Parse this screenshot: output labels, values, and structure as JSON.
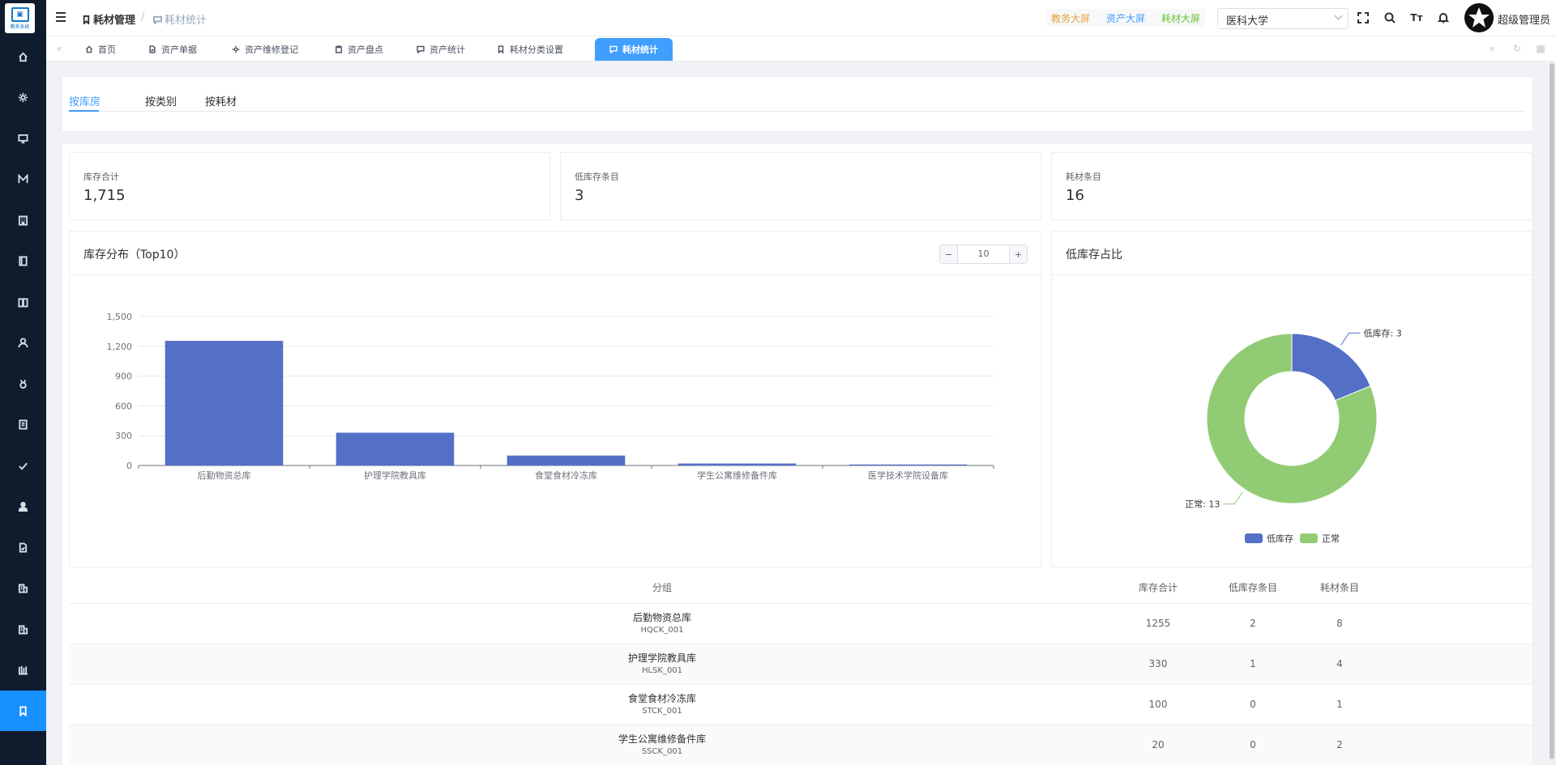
{
  "app": {
    "logo_caption": "教务系统"
  },
  "header": {
    "breadcrumb": [
      "耗材管理",
      "/",
      "耗材统计"
    ],
    "screen_links": [
      "教务大屏",
      "资产大屏",
      "耗材大屏"
    ],
    "org_select": "医科大学",
    "font_icon_text": "Tт",
    "user": "超级管理员"
  },
  "sidebar": {
    "items": [
      {
        "icon": "home-icon"
      },
      {
        "icon": "settings-icon"
      },
      {
        "icon": "monitor-icon"
      },
      {
        "icon": "brand-m-icon"
      },
      {
        "icon": "building-icon"
      },
      {
        "icon": "book-icon"
      },
      {
        "icon": "open-book-icon"
      },
      {
        "icon": "user-icon"
      },
      {
        "icon": "medal-icon"
      },
      {
        "icon": "notebook-icon"
      },
      {
        "icon": "check-icon"
      },
      {
        "icon": "person-icon"
      },
      {
        "icon": "document-icon"
      },
      {
        "icon": "office-icon"
      },
      {
        "icon": "office2-icon"
      },
      {
        "icon": "library-icon"
      },
      {
        "icon": "bookmark-icon",
        "active": true
      }
    ]
  },
  "tags": [
    {
      "label": "首页",
      "icon": "home-icon"
    },
    {
      "label": "资产单据",
      "icon": "document-icon"
    },
    {
      "label": "资产维修登记",
      "icon": "gear-icon"
    },
    {
      "label": "资产盘点",
      "icon": "clipboard-icon"
    },
    {
      "label": "资产统计",
      "icon": "chat-icon"
    },
    {
      "label": "耗材分类设置",
      "icon": "bookmark-icon"
    },
    {
      "label": "耗材统计",
      "icon": "chat-icon",
      "active": true
    }
  ],
  "subtabs": [
    "按库房",
    "按类别",
    "按耗材"
  ],
  "stats": [
    {
      "label": "库存合计",
      "value": "1,715"
    },
    {
      "label": "低库存条目",
      "value": "3"
    },
    {
      "label": "耗材条目",
      "value": "16"
    }
  ],
  "bar_panel": {
    "title": "库存分布（Top10）",
    "stepper_value": "10",
    "minus": "−",
    "plus": "+"
  },
  "pie_panel": {
    "title": "低库存占比"
  },
  "chart_data": [
    {
      "type": "bar",
      "categories": [
        "后勤物资总库",
        "护理学院教具库",
        "食堂食材冷冻库",
        "学生公寓维修备件库",
        "医学技术学院设备库"
      ],
      "values": [
        1255,
        330,
        100,
        20,
        10
      ],
      "ylim": [
        0,
        1500
      ],
      "yticks": [
        "0",
        "300",
        "600",
        "900",
        "1,200",
        "1,500"
      ],
      "grid": true,
      "color": "#5470c6"
    },
    {
      "type": "pie",
      "donut": true,
      "labels": [
        "低库存",
        "正常"
      ],
      "values": [
        3,
        13
      ],
      "label_texts": [
        "低库存: 3",
        "正常: 13"
      ],
      "colors": [
        "#5470c6",
        "#91cc75"
      ],
      "legend": "bottom"
    }
  ],
  "table": {
    "headers": [
      "分组",
      "库存合计",
      "低库存条目",
      "耗材条目"
    ],
    "rows": [
      {
        "name": "后勤物资总库",
        "code": "HQCK_001",
        "total": "1255",
        "low": "2",
        "items": "8"
      },
      {
        "name": "护理学院教具库",
        "code": "HLSK_001",
        "total": "330",
        "low": "1",
        "items": "4"
      },
      {
        "name": "食堂食材冷冻库",
        "code": "STCK_001",
        "total": "100",
        "low": "0",
        "items": "1"
      },
      {
        "name": "学生公寓维修备件库",
        "code": "SSCK_001",
        "total": "20",
        "low": "0",
        "items": "2"
      }
    ]
  }
}
